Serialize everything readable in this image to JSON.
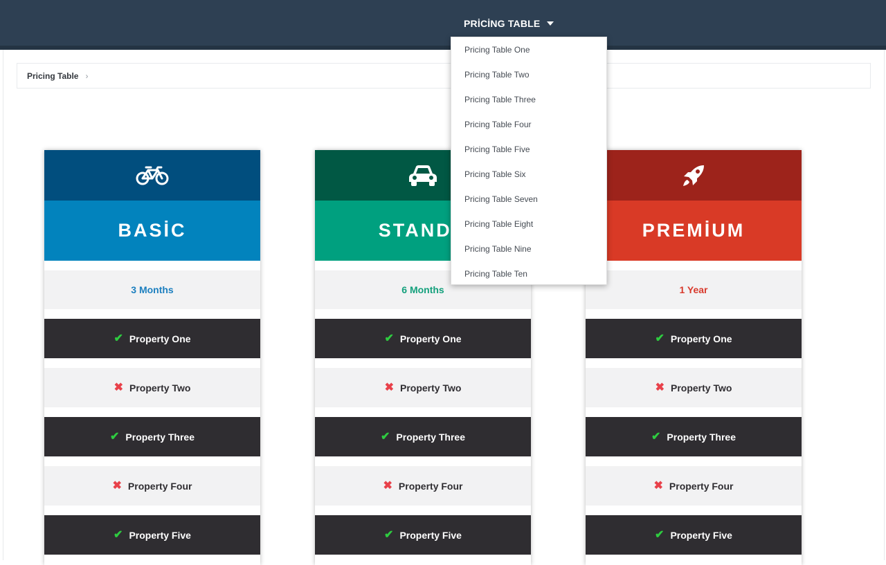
{
  "nav": {
    "trigger_label": "PRİCİNG TABLE",
    "menu_items": [
      "Pricing Table One",
      "Pricing Table Two",
      "Pricing Table Three",
      "Pricing Table Four",
      "Pricing Table Five",
      "Pricing Table Six",
      "Pricing Table Seven",
      "Pricing Table Eight",
      "Pricing Table Nine",
      "Pricing Table Ten"
    ]
  },
  "breadcrumb": {
    "item": "Pricing Table"
  },
  "plans": [
    {
      "icon": "bicycle-icon",
      "title": "BASİC",
      "period": "3 Months",
      "colors": {
        "header_dark": "#014e7e",
        "header": "#0283bd",
        "accent": "#1c7fbf"
      },
      "features": [
        {
          "label": "Property One",
          "included": true
        },
        {
          "label": "Property Two",
          "included": false
        },
        {
          "label": "Property Three",
          "included": true
        },
        {
          "label": "Property Four",
          "included": false
        },
        {
          "label": "Property Five",
          "included": true
        }
      ]
    },
    {
      "icon": "car-icon",
      "title": "STANDA",
      "period": "6 Months",
      "colors": {
        "header_dark": "#015844",
        "header": "#00a07f",
        "accent": "#14a07c"
      },
      "features": [
        {
          "label": "Property One",
          "included": true
        },
        {
          "label": "Property Two",
          "included": false
        },
        {
          "label": "Property Three",
          "included": true
        },
        {
          "label": "Property Four",
          "included": false
        },
        {
          "label": "Property Five",
          "included": true
        }
      ]
    },
    {
      "icon": "rocket-icon",
      "title": "PREMİUM",
      "period": "1 Year",
      "colors": {
        "header_dark": "#9d231b",
        "header": "#d93a26",
        "accent": "#d83a2c"
      },
      "features": [
        {
          "label": "Property One",
          "included": true
        },
        {
          "label": "Property Two",
          "included": false
        },
        {
          "label": "Property Three",
          "included": true
        },
        {
          "label": "Property Four",
          "included": false
        },
        {
          "label": "Property Five",
          "included": true
        }
      ]
    }
  ],
  "marks": {
    "check": "✔",
    "cross": "✖"
  },
  "colors": {
    "navbar": "#2e4053",
    "feature_dark": "#2f2d31",
    "check": "#2ecc40",
    "cross": "#e8414a"
  }
}
